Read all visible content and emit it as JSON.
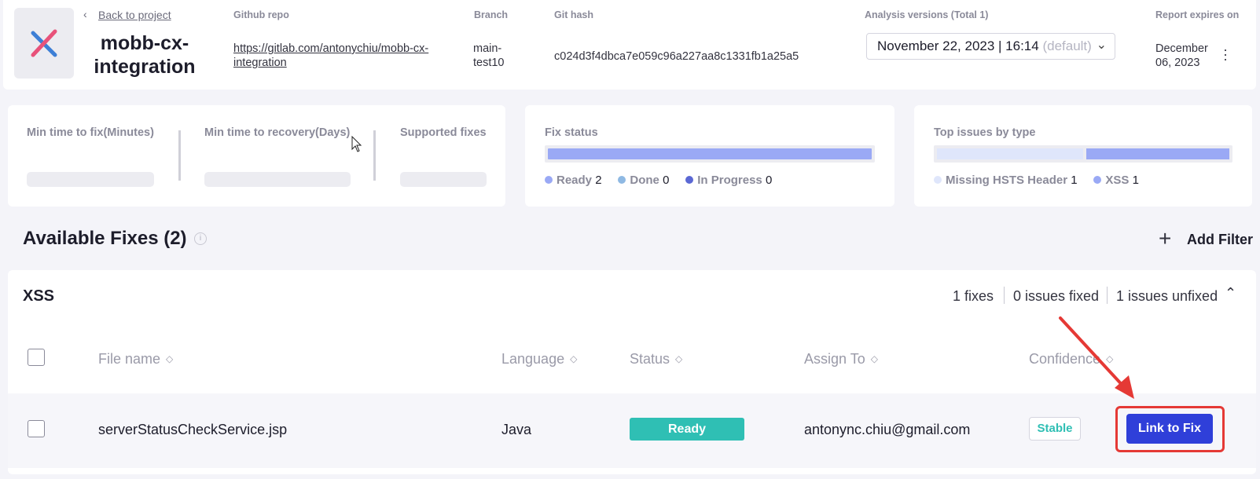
{
  "header": {
    "back_label": "Back to project",
    "project_name": "mobb-cx-integration",
    "github_repo_label": "Github repo",
    "github_repo_value": "https://gitlab.com/antonychiu/mobb-cx-integration",
    "branch_label": "Branch",
    "branch_value": "main-test10",
    "git_hash_label": "Git hash",
    "git_hash_value": "c024d3f4dbca7e059c96a227aa8c1331fb1a25a5",
    "versions_label": "Analysis versions (Total 1)",
    "version_selected": "November 22, 2023 | 16:14",
    "version_default_tag": "(default)",
    "expires_label": "Report expires on",
    "expires_value": "December 06, 2023"
  },
  "metrics": {
    "min_time_fix_label": "Min time to fix(Minutes)",
    "min_time_recovery_label": "Min time to recovery(Days)",
    "supported_fixes_label": "Supported fixes"
  },
  "fix_status": {
    "title": "Fix status",
    "items": [
      {
        "label": "Ready",
        "count": "2",
        "color": "#9aa9f5"
      },
      {
        "label": "Done",
        "count": "0",
        "color": "#8fb9e3"
      },
      {
        "label": "In Progress",
        "count": "0",
        "color": "#5b68d4"
      }
    ],
    "bar_fill_fraction": 1.0
  },
  "top_issues": {
    "title": "Top issues by type",
    "items": [
      {
        "label": "Missing HSTS Header",
        "count": "1",
        "color": "#dfe6fb"
      },
      {
        "label": "XSS",
        "count": "1",
        "color": "#9aa9f5"
      }
    ]
  },
  "available_fixes": {
    "title": "Available Fixes (2)",
    "add_filter_label": "Add Filter"
  },
  "group": {
    "name": "XSS",
    "fixes": "1 fixes",
    "issues_fixed": "0 issues fixed",
    "issues_unfixed": "1 issues unfixed",
    "columns": [
      "File name",
      "Language",
      "Status",
      "Assign To",
      "Confidence"
    ],
    "rows": [
      {
        "file_name": "serverStatusCheckService.jsp",
        "language": "Java",
        "status": "Ready",
        "assign_to": "antonync.chiu@gmail.com",
        "confidence": "Stable",
        "action_label": "Link to Fix"
      }
    ]
  },
  "colors": {
    "accent": "#2f3fd9",
    "status_ready": "#2fbfb4",
    "highlight_annotation": "#e53935"
  }
}
